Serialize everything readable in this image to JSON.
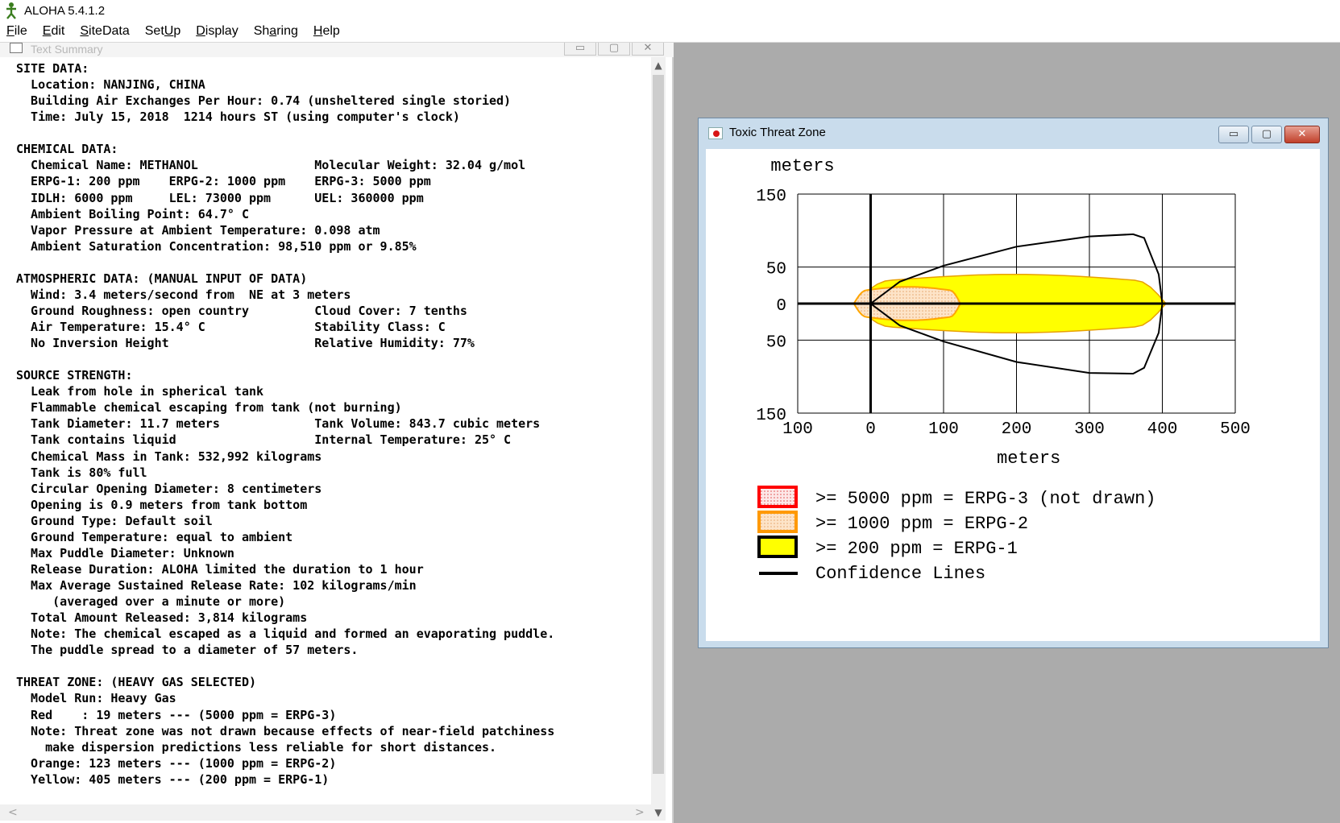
{
  "app": {
    "title": "ALOHA 5.4.1.2",
    "icon": "aloha-figure-icon"
  },
  "menu": [
    {
      "label": "File",
      "key": "F",
      "rest": "ile"
    },
    {
      "label": "Edit",
      "key": "E",
      "rest": "dit"
    },
    {
      "label": "SiteData",
      "key": "S",
      "rest": "iteData"
    },
    {
      "label": "SetUp",
      "key": "",
      "rest": "SetUp",
      "pre": "Set",
      "k2": "U",
      "post": "p"
    },
    {
      "label": "Display",
      "key": "D",
      "rest": "isplay"
    },
    {
      "label": "Sharing",
      "key": "",
      "pre": "Sh",
      "k2": "a",
      "post": "ring"
    },
    {
      "label": "Help",
      "key": "H",
      "rest": "elp"
    }
  ],
  "text_summary": {
    "title": "Text Summary",
    "controls": {
      "minimize": "▭",
      "restore": "▢",
      "close": "✕"
    },
    "lines": [
      "SITE DATA:",
      "  Location: NANJING, CHINA",
      "  Building Air Exchanges Per Hour: 0.74 (unsheltered single storied)",
      "  Time: July 15, 2018  1214 hours ST (using computer's clock)",
      "",
      "CHEMICAL DATA:",
      "  Chemical Name: METHANOL                Molecular Weight: 32.04 g/mol",
      "  ERPG-1: 200 ppm    ERPG-2: 1000 ppm    ERPG-3: 5000 ppm",
      "  IDLH: 6000 ppm     LEL: 73000 ppm      UEL: 360000 ppm",
      "  Ambient Boiling Point: 64.7° C",
      "  Vapor Pressure at Ambient Temperature: 0.098 atm",
      "  Ambient Saturation Concentration: 98,510 ppm or 9.85%",
      "",
      "ATMOSPHERIC DATA: (MANUAL INPUT OF DATA)",
      "  Wind: 3.4 meters/second from  NE at 3 meters",
      "  Ground Roughness: open country         Cloud Cover: 7 tenths",
      "  Air Temperature: 15.4° C               Stability Class: C",
      "  No Inversion Height                    Relative Humidity: 77%",
      "",
      "SOURCE STRENGTH:",
      "  Leak from hole in spherical tank",
      "  Flammable chemical escaping from tank (not burning)",
      "  Tank Diameter: 11.7 meters             Tank Volume: 843.7 cubic meters",
      "  Tank contains liquid                   Internal Temperature: 25° C",
      "  Chemical Mass in Tank: 532,992 kilograms",
      "  Tank is 80% full",
      "  Circular Opening Diameter: 8 centimeters",
      "  Opening is 0.9 meters from tank bottom",
      "  Ground Type: Default soil",
      "  Ground Temperature: equal to ambient",
      "  Max Puddle Diameter: Unknown",
      "  Release Duration: ALOHA limited the duration to 1 hour",
      "  Max Average Sustained Release Rate: 102 kilograms/min",
      "     (averaged over a minute or more)",
      "  Total Amount Released: 3,814 kilograms",
      "  Note: The chemical escaped as a liquid and formed an evaporating puddle.",
      "  The puddle spread to a diameter of 57 meters.",
      "",
      "THREAT ZONE: (HEAVY GAS SELECTED)",
      "  Model Run: Heavy Gas",
      "  Red    : 19 meters --- (5000 ppm = ERPG-3)",
      "  Note: Threat zone was not drawn because effects of near-field patchiness",
      "    make dispersion predictions less reliable for short distances.",
      "  Orange: 123 meters --- (1000 ppm = ERPG-2)",
      "  Yellow: 405 meters --- (200 ppm = ERPG-1)"
    ]
  },
  "threat_window": {
    "title": "Toxic Threat Zone",
    "controls": {
      "minimize": "▭",
      "restore": "▢",
      "close": "✕"
    }
  },
  "chart_data": {
    "type": "area",
    "ylabel": "meters",
    "xlabel": "meters",
    "xlim": [
      -100,
      500
    ],
    "ylim": [
      -150,
      150
    ],
    "x_ticks": [
      -100,
      0,
      100,
      200,
      300,
      400,
      500
    ],
    "x_tick_labels": [
      "100",
      "0",
      "100",
      "200",
      "300",
      "400",
      "500"
    ],
    "y_ticks": [
      150,
      50,
      0,
      -50,
      -150
    ],
    "y_tick_labels": [
      "150",
      "50",
      "0",
      "50",
      "150"
    ],
    "grid": true,
    "zones": [
      {
        "name": "ERPG-2",
        "color": "#ffa500",
        "fill": "#fce4cc",
        "x_extent": [
          -23,
          123
        ],
        "y_halfwidth_max": 23
      },
      {
        "name": "ERPG-1",
        "color": "#e8a000",
        "fill": "#ffff00",
        "x_extent": [
          -23,
          405
        ],
        "y_halfwidth_max": 40
      }
    ],
    "confidence_lines": {
      "upper": [
        [
          0,
          0
        ],
        [
          40,
          30
        ],
        [
          100,
          52
        ],
        [
          200,
          78
        ],
        [
          300,
          92
        ],
        [
          360,
          95
        ],
        [
          375,
          90
        ],
        [
          395,
          40
        ],
        [
          400,
          0
        ]
      ],
      "lower": [
        [
          0,
          0
        ],
        [
          40,
          -30
        ],
        [
          100,
          -52
        ],
        [
          200,
          -80
        ],
        [
          300,
          -95
        ],
        [
          360,
          -96
        ],
        [
          375,
          -88
        ],
        [
          395,
          -40
        ],
        [
          400,
          0
        ]
      ]
    },
    "legend": [
      {
        "label": ">= 5000 ppm = ERPG-3 (not drawn)",
        "border": "#ff0000",
        "fill": "#fbe0e0",
        "pattern": "dots"
      },
      {
        "label": ">= 1000 ppm = ERPG-2",
        "border": "#ff9900",
        "fill": "#fbd9b8",
        "pattern": "dots"
      },
      {
        "label": ">= 200 ppm = ERPG-1",
        "border": "#000000",
        "fill": "#ffff00",
        "pattern": "solid"
      },
      {
        "label": "Confidence Lines",
        "border": "#000000",
        "fill": "none",
        "pattern": "line"
      }
    ]
  }
}
